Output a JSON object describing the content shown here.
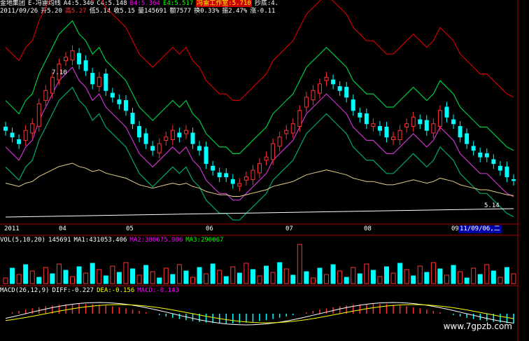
{
  "header": {
    "stock_name": "金地集团",
    "indicator": "E-冯雷均线",
    "a4": "A4:5.340",
    "c4": "C4:5.148",
    "b4": "B4:5.364",
    "e4": "E4:5.517",
    "studio": "冯雷工作室:5.710",
    "bottom_hunt": "抄底:4."
  },
  "ohlc": {
    "date": "2011/09/26",
    "open": "开5.20",
    "high": "高5.27",
    "low": "低5.14",
    "close": "收5.15",
    "volume": "量145691",
    "amount": "额7577",
    "turnover": "换0.33%",
    "amplitude": "振2.47%",
    "change": "涨-0.11"
  },
  "price_annotations": {
    "high_mark": "7.10",
    "low_mark": "5.14"
  },
  "axis": {
    "months": [
      "2011",
      "04",
      "05",
      "06",
      "07",
      "08",
      "09"
    ],
    "cursor_date": "11/09/06,二"
  },
  "volume": {
    "title": "VOL(5,10,20)",
    "value": "145691",
    "ma1": "MA1:431053.406",
    "ma2": "MA2:380675.906",
    "ma3": "MA3:290067"
  },
  "macd": {
    "title": "MACD(26,12,9)",
    "diff": "DIFF:-0.227",
    "dea": "DEA:-0.156",
    "macd": "MACD:-0.143"
  },
  "watermark": "www.7gpzb.com",
  "chart_data": {
    "type": "candlestick",
    "date_range": [
      "2011",
      "09"
    ],
    "close_series": [
      5.9,
      5.8,
      5.7,
      5.9,
      6.0,
      6.3,
      6.5,
      6.7,
      6.9,
      7.0,
      7.1,
      6.9,
      6.8,
      6.6,
      6.7,
      6.5,
      6.4,
      6.3,
      6.2,
      6.0,
      5.8,
      5.7,
      5.6,
      5.7,
      5.8,
      5.9,
      5.8,
      5.9,
      5.7,
      5.6,
      5.4,
      5.3,
      5.2,
      5.2,
      5.1,
      5.1,
      5.2,
      5.3,
      5.4,
      5.5,
      5.7,
      5.8,
      5.9,
      6.0,
      6.2,
      6.4,
      6.5,
      6.6,
      6.7,
      6.6,
      6.5,
      6.4,
      6.2,
      6.1,
      6.0,
      6.0,
      5.9,
      5.8,
      5.8,
      5.9,
      6.0,
      6.1,
      6.0,
      5.9,
      6.0,
      6.2,
      6.1,
      6.0,
      5.8,
      5.7,
      5.6,
      5.5,
      5.5,
      5.4,
      5.3,
      5.2,
      5.15
    ],
    "annotations": [
      "7.10",
      "5.14"
    ]
  }
}
